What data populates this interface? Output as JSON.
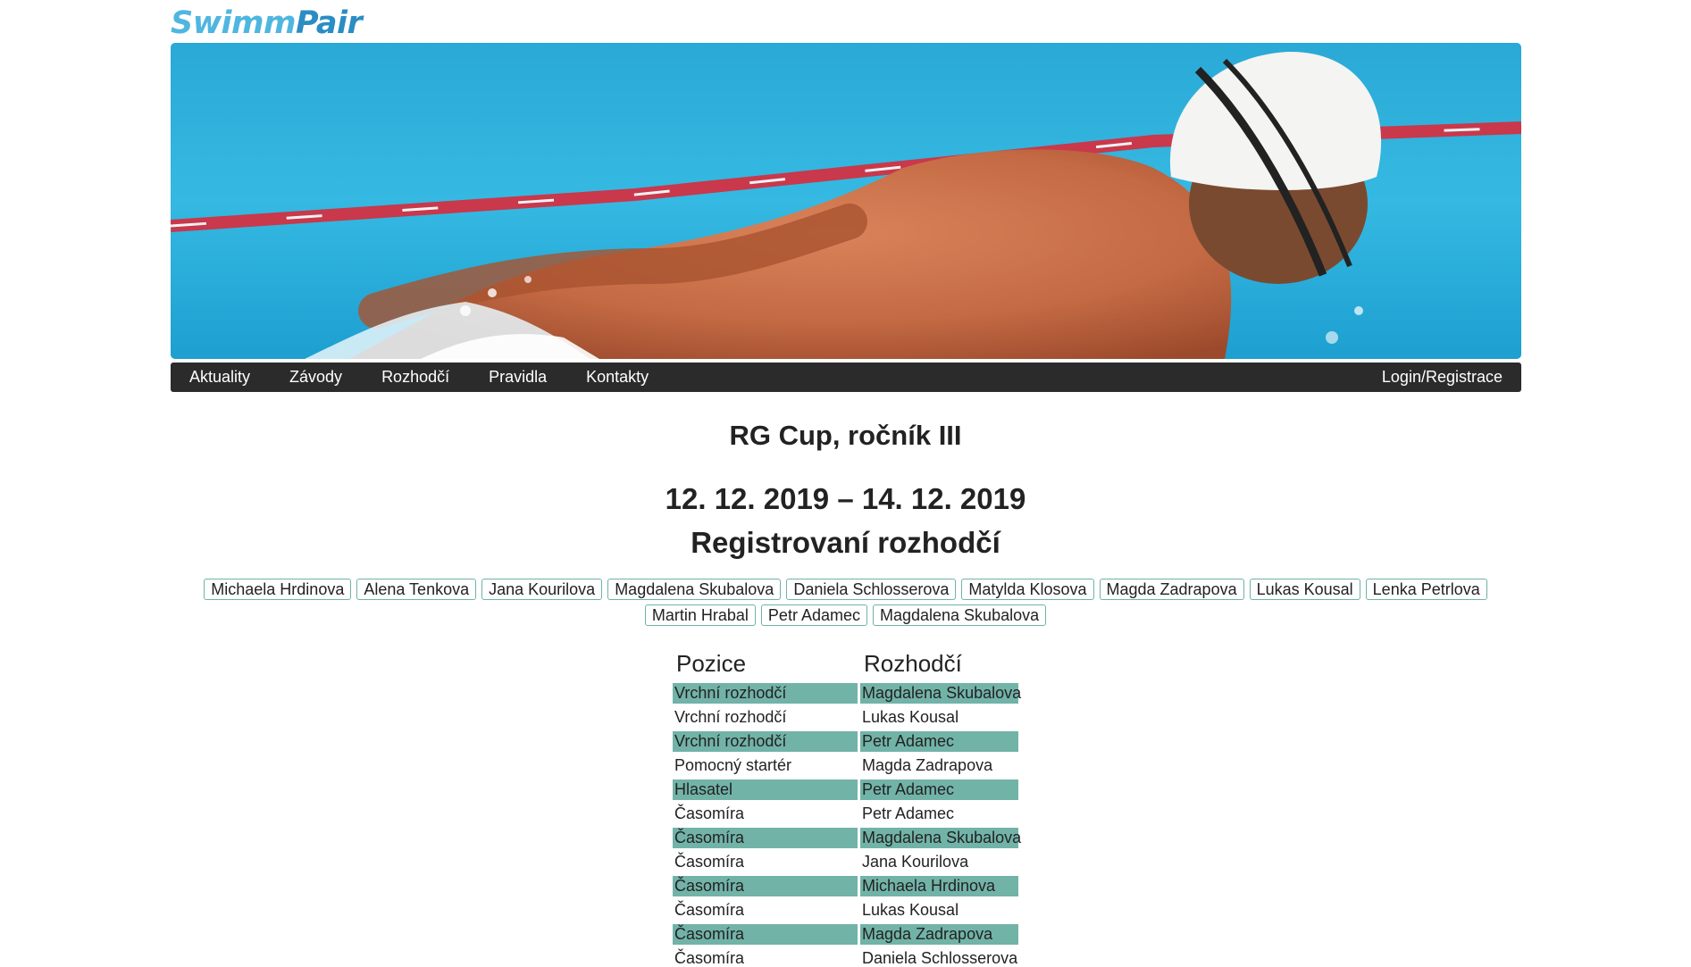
{
  "logo": {
    "part1": "Swimm",
    "part2": "Pair"
  },
  "nav": {
    "items": [
      "Aktuality",
      "Závody",
      "Rozhodčí",
      "Pravidla",
      "Kontakty"
    ],
    "login": "Login/Registrace"
  },
  "event": {
    "title": "RG Cup, ročník III",
    "dates": "12. 12. 2019 – 14. 12. 2019",
    "section": "Registrovaní rozhodčí"
  },
  "referees_row1": [
    "Michaela Hrdinova",
    "Alena Tenkova",
    "Jana Kourilova",
    "Magdalena Skubalova",
    "Daniela Schlosserova",
    "Matylda Klosova",
    "Magda Zadrapova",
    "Lukas Kousal",
    "Lenka Petrlova"
  ],
  "referees_row2": [
    "Martin Hrabal",
    "Petr Adamec",
    "Magdalena Skubalova"
  ],
  "table": {
    "headers": [
      "Pozice",
      "Rozhodčí"
    ],
    "rows": [
      [
        "Vrchní rozhodčí",
        "Magdalena Skubalova"
      ],
      [
        "Vrchní rozhodčí",
        "Lukas Kousal"
      ],
      [
        "Vrchní rozhodčí",
        "Petr Adamec"
      ],
      [
        "Pomocný startér",
        "Magda Zadrapova"
      ],
      [
        "Hlasatel",
        "Petr Adamec"
      ],
      [
        "Časomíra",
        "Petr Adamec"
      ],
      [
        "Časomíra",
        "Magdalena Skubalova"
      ],
      [
        "Časomíra",
        "Jana Kourilova"
      ],
      [
        "Časomíra",
        "Michaela Hrdinova"
      ],
      [
        "Časomíra",
        "Lukas Kousal"
      ],
      [
        "Časomíra",
        "Magda Zadrapova"
      ],
      [
        "Časomíra",
        "Daniela Schlosserova"
      ]
    ]
  },
  "colors": {
    "accent": "#72b3a8",
    "navbar": "#2b2b2b",
    "logo": "#4fb6e0"
  }
}
